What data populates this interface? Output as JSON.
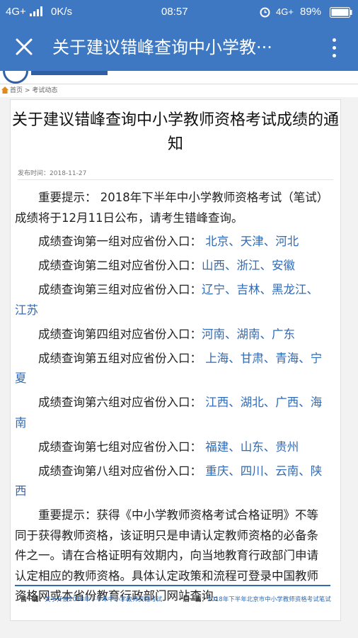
{
  "status_bar": {
    "network": "4G+",
    "speed": "0K/s",
    "time": "08:57",
    "network_right": "4G+",
    "battery": "89%"
  },
  "app_bar": {
    "title": "关于建议错峰查询中小学教···"
  },
  "breadcrumb": {
    "home": "首页",
    "separator": ">",
    "section": "考试动态"
  },
  "article": {
    "title": "关于建议错峰查询中小学教师资格考试成绩的通知",
    "publish_label": "发布时间：",
    "publish_date": "2018-11-27",
    "intro": "重要提示：  2018年下半年中小学教师资格考试（笔试）成绩将于12月11日公布，请考生错峰查询。",
    "groups": [
      {
        "label": "成绩查询第一组对应省份入口：",
        "provinces": "北京、天津、河北"
      },
      {
        "label": "成绩查询第二组对应省份入口：",
        "provinces": "山西、浙江、安徽"
      },
      {
        "label": "成绩查询第三组对应省份入口：",
        "provinces": "辽宁、吉林、黑龙江、江苏"
      },
      {
        "label": "成绩查询第四组对应省份入口：",
        "provinces": "河南、湖南、广东"
      },
      {
        "label": "成绩查询第五组对应省份入口：",
        "provinces": "上海、甘肃、青海、宁夏"
      },
      {
        "label": "成绩查询第六组对应省份入口：",
        "provinces": "江西、湖北、广西、海南"
      },
      {
        "label": "成绩查询第七组对应省份入口：",
        "provinces": "福建、山东、贵州"
      },
      {
        "label": "成绩查询第八组对应省份入口：",
        "provinces": "重庆、四川、云南、陕西"
      }
    ],
    "note": "重要提示：获得《中小学教师资格考试合格证明》不等同于获得教师资格，该证明只是申请认定教师资格的必备条件之一。请在合格证明有效期内，向当地教育行政部门申请认定相应的教师资格。具体认定政策和流程可登录中国教师资格网或本省份教育行政部门网站查询。"
  },
  "navigation": {
    "prev_label": "前一篇：",
    "prev_title": "关于开展2018年下半年中小学教师资格考试",
    "next_label": "后一篇：",
    "next_title": "2018年下半年北京市中小学教师资格考试笔试"
  },
  "colors": {
    "header_blue": "#3e77c2",
    "link_blue": "#2f6bb7"
  },
  "icons": {
    "close": "close-icon",
    "more": "more-vert-icon",
    "home": "home-icon",
    "alarm": "alarm-icon"
  }
}
